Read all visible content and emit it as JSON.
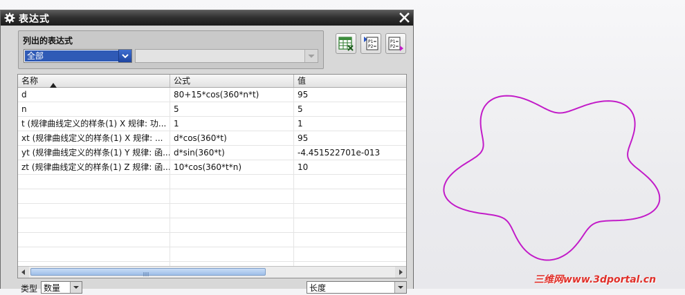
{
  "window": {
    "title": "表达式",
    "gear_icon": "gear-icon",
    "close_icon": "close-icon"
  },
  "list_group": {
    "title": "列出的表达式",
    "filter_value": "全部",
    "filter2_value": ""
  },
  "toolbar": {
    "spreadsheet_icon": "spreadsheet-icon",
    "p1p2_in_icon": "p1p2-import-icon",
    "p1p2_out_icon": "p1p2-export-icon",
    "p1p2_text": [
      "P1=",
      "P2="
    ]
  },
  "table": {
    "columns": [
      "名称",
      "公式",
      "值"
    ],
    "rows": [
      {
        "name": "d",
        "formula": "80+15*cos(360*n*t)",
        "value": "95"
      },
      {
        "name": "n",
        "formula": "5",
        "value": "5"
      },
      {
        "name": "t  (规律曲线定义的样条(1) X 规律: 功...",
        "formula": "1",
        "value": "1"
      },
      {
        "name": "xt  (规律曲线定义的样条(1) X 规律: ...",
        "formula": "d*cos(360*t)",
        "value": "95"
      },
      {
        "name": "yt  (规律曲线定义的样条(1) Y 规律: 函...",
        "formula": "d*sin(360*t)",
        "value": "-4.451522701e-013"
      },
      {
        "name": "zt  (规律曲线定义的样条(1) Z 规律: 函...",
        "formula": "10*cos(360*t*n)",
        "value": "10"
      },
      {
        "name": "",
        "formula": "",
        "value": ""
      },
      {
        "name": "",
        "formula": "",
        "value": ""
      },
      {
        "name": "",
        "formula": "",
        "value": ""
      },
      {
        "name": "",
        "formula": "",
        "value": ""
      },
      {
        "name": "",
        "formula": "",
        "value": ""
      },
      {
        "name": "",
        "formula": "",
        "value": ""
      },
      {
        "name": "",
        "formula": "",
        "value": ""
      }
    ]
  },
  "bottom": {
    "type_label": "类型",
    "type_value": "数量",
    "unit_value": "长度"
  },
  "curve": {
    "color": "#c21bc8",
    "lobes": 5,
    "base_radius": 80,
    "amplitude": 15
  },
  "watermark": "三维网www.3dportal.cn",
  "colors": {
    "selection": "#2f5ab6",
    "titlebar": "#2e2e2e"
  }
}
